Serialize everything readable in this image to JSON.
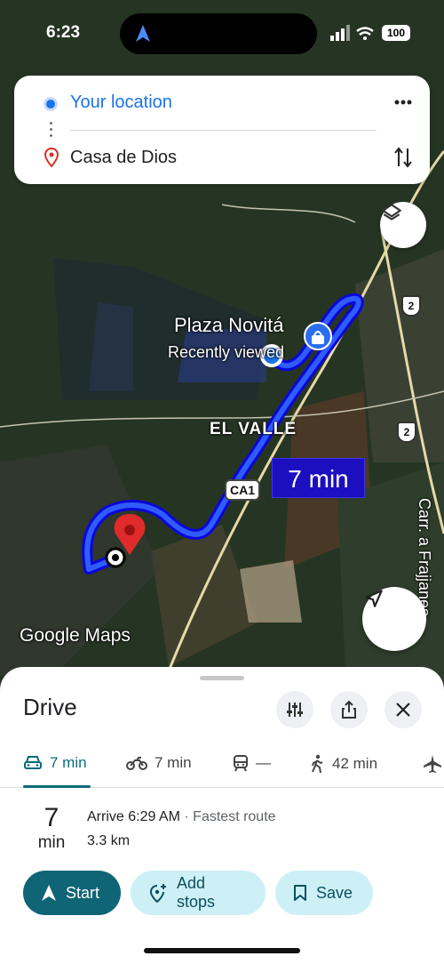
{
  "status_bar": {
    "time": "6:23",
    "battery": "100"
  },
  "route": {
    "origin": "Your location",
    "destination": "Casa de Dios"
  },
  "map": {
    "poi_name": "Plaza Novitá",
    "poi_subtitle": "Recently viewed",
    "area_label": "EL VALLE",
    "road_name": "Carr. a Frajjanes",
    "route_badge": "CA1",
    "shield_numbers": [
      "2",
      "2"
    ],
    "duration_label": "7 min",
    "attribution": "Google Maps",
    "route_color": "#1a1aff"
  },
  "sheet": {
    "title": "Drive",
    "modes": [
      {
        "icon": "car-icon",
        "label": "7 min",
        "active": true
      },
      {
        "icon": "motorcycle-icon",
        "label": "7 min",
        "active": false
      },
      {
        "icon": "transit-icon",
        "label": "—",
        "active": false
      },
      {
        "icon": "walk-icon",
        "label": "42 min",
        "active": false
      },
      {
        "icon": "flight-icon",
        "label": "",
        "active": false
      }
    ],
    "result": {
      "time_value": "7",
      "time_unit": "min",
      "arrive": "Arrive 6:29 AM",
      "separator": "·",
      "route_tag": "Fastest route",
      "distance": "3.3 km"
    },
    "actions": {
      "start": "Start",
      "add_stops": "Add stops",
      "save": "Save"
    }
  },
  "colors": {
    "accent": "#0f6476",
    "pill_bg": "#cdf0f7",
    "link_blue": "#1a73e8"
  }
}
